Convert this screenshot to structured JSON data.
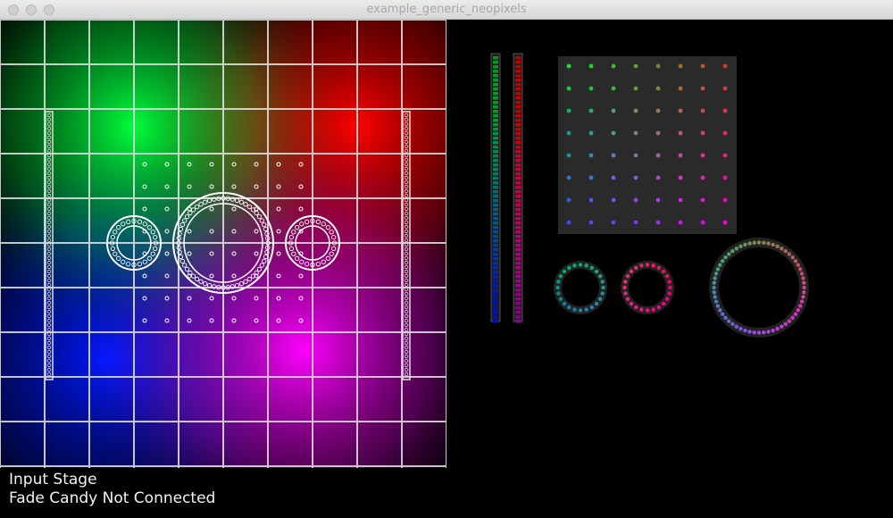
{
  "window": {
    "title": "example_generic_neopixels"
  },
  "stage": {
    "colors": {
      "green": "#00ff3c",
      "red": "#ff0000",
      "blue": "#0018ff",
      "magenta": "#ff00ff",
      "grid": "#e8e8e8"
    }
  },
  "status": {
    "stage_label": "Input Stage",
    "connection_text": "Fade Candy Not Connected"
  }
}
